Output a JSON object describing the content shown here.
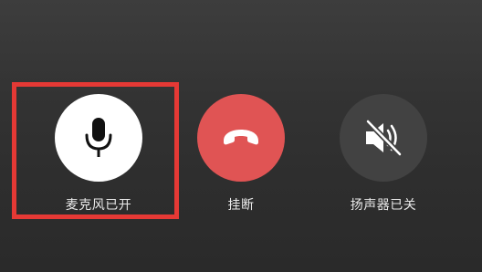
{
  "call_controls": {
    "microphone": {
      "label": "麦克风已开",
      "icon": "microphone-icon",
      "state": "on",
      "background": "#ffffff",
      "icon_color": "#111111"
    },
    "hangup": {
      "label": "挂断",
      "icon": "phone-hangup-icon",
      "background": "#e05454",
      "icon_color": "#ffffff"
    },
    "speaker": {
      "label": "扬声器已关",
      "icon": "speaker-muted-icon",
      "state": "off",
      "background": "#424242",
      "icon_color": "#ffffff"
    }
  },
  "highlight": {
    "target": "microphone",
    "color": "#e53935"
  }
}
